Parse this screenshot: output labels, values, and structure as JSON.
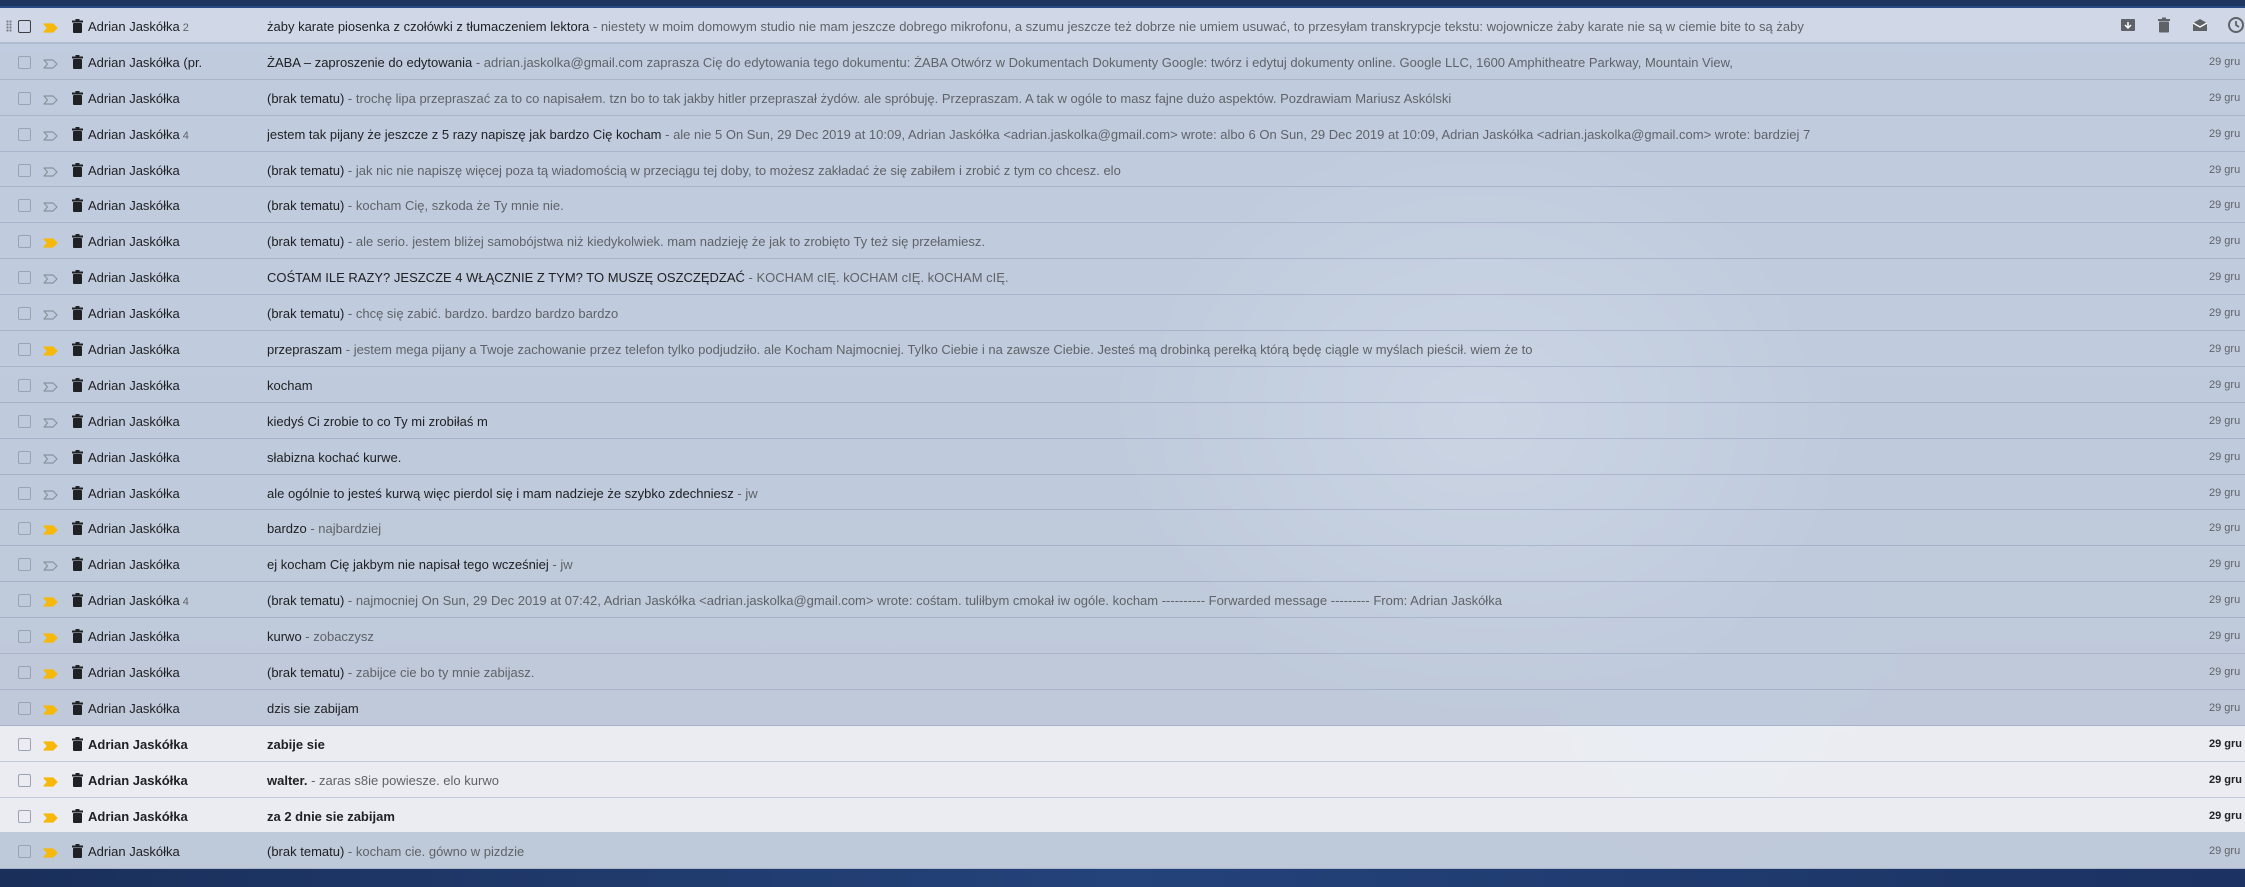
{
  "colors": {
    "important_marker": "#f6b80a",
    "not_important_marker": "#8a929c",
    "row_bg": "#dae2ee",
    "unread_row_bg": "#f6f7fa"
  },
  "hover_actions": {
    "icons": [
      "archive-icon",
      "delete-icon",
      "mark-read-icon",
      "snooze-icon"
    ]
  },
  "emails": [
    {
      "sender": "Adrian Jaskółka",
      "count": "2",
      "subject": "żaby karate piosenka z czołówki z tłumaczeniem lektora",
      "snippet": " - niestety w moim domowym studio nie mam jeszcze dobrego mikrofonu, a szumu jeszcze też dobrze nie umiem usuwać, to przesyłam transkrypcje tekstu: wojownicze żaby karate nie są w ciemie bite to są żaby",
      "date": "",
      "important": true,
      "unread": false,
      "hovered": true
    },
    {
      "sender": "Adrian Jaskółka (pr.",
      "count": "",
      "subject": "ŻABA – zaproszenie do edytowania",
      "snippet": " - adrian.jaskolka@gmail.com zaprasza Cię do edytowania tego dokumentu: ŻABA Otwórz w Dokumentach Dokumenty Google: twórz i edytuj dokumenty online. Google LLC, 1600 Amphitheatre Parkway, Mountain View,",
      "date": "29 gru",
      "important": false,
      "unread": false
    },
    {
      "sender": "Adrian Jaskółka",
      "count": "",
      "subject": "(brak tematu)",
      "snippet": " - trochę lipa przepraszać za to co napisałem. tzn bo to tak jakby hitler przepraszał żydów. ale spróbuję. Przepraszam. A tak w ogóle to masz fajne dużo aspektów. Pozdrawiam Mariusz Askólski",
      "date": "29 gru",
      "important": false,
      "unread": false
    },
    {
      "sender": "Adrian Jaskółka",
      "count": "4",
      "subject": "jestem tak pijany że jeszcze z 5 razy napiszę jak bardzo Cię kocham",
      "snippet": " - ale nie 5 On Sun, 29 Dec 2019 at 10:09, Adrian Jaskółka <adrian.jaskolka@gmail.com> wrote: albo 6 On Sun, 29 Dec 2019 at 10:09, Adrian Jaskółka <adrian.jaskolka@gmail.com> wrote: bardziej 7",
      "date": "29 gru",
      "important": false,
      "unread": false
    },
    {
      "sender": "Adrian Jaskółka",
      "count": "",
      "subject": "(brak tematu)",
      "snippet": " - jak nic nie napiszę więcej poza tą wiadomością w przeciągu tej doby, to możesz zakładać że się zabiłem i zrobić z tym co chcesz. elo",
      "date": "29 gru",
      "important": false,
      "unread": false
    },
    {
      "sender": "Adrian Jaskółka",
      "count": "",
      "subject": "(brak tematu)",
      "snippet": " - kocham Cię, szkoda że Ty mnie nie.",
      "date": "29 gru",
      "important": false,
      "unread": false
    },
    {
      "sender": "Adrian Jaskółka",
      "count": "",
      "subject": "(brak tematu)",
      "snippet": " - ale serio. jestem bliżej samobójstwa niż kiedykolwiek. mam nadzieję że jak to zrobięto Ty też się przełamiesz.",
      "date": "29 gru",
      "important": true,
      "unread": false
    },
    {
      "sender": "Adrian Jaskółka",
      "count": "",
      "subject": "COŚTAM ILE RAZY? JESZCZE 4 WŁĄCZNIE Z TYM? TO MUSZĘ OSZCZĘDZAĆ",
      "snippet": " - KOCHAM cIĘ. kOCHAM cIĘ. kOCHAM cIĘ.",
      "date": "29 gru",
      "important": false,
      "unread": false
    },
    {
      "sender": "Adrian Jaskółka",
      "count": "",
      "subject": "(brak tematu)",
      "snippet": " - chcę się zabić. bardzo. bardzo bardzo bardzo",
      "date": "29 gru",
      "important": false,
      "unread": false
    },
    {
      "sender": "Adrian Jaskółka",
      "count": "",
      "subject": "przepraszam",
      "snippet": " - jestem mega pijany a Twoje zachowanie przez telefon tylko podjudziło. ale Kocham Najmocniej. Tylko Ciebie i na zawsze Ciebie. Jesteś mą drobinką perełką którą będę ciągle w myślach pieścił. wiem że to",
      "date": "29 gru",
      "important": true,
      "unread": false
    },
    {
      "sender": "Adrian Jaskółka",
      "count": "",
      "subject": "kocham",
      "snippet": "",
      "date": "29 gru",
      "important": false,
      "unread": false
    },
    {
      "sender": "Adrian Jaskółka",
      "count": "",
      "subject": "kiedyś Ci zrobie to co Ty mi zrobiłaś m",
      "snippet": "",
      "date": "29 gru",
      "important": false,
      "unread": false
    },
    {
      "sender": "Adrian Jaskółka",
      "count": "",
      "subject": "słabizna kochać kurwe.",
      "snippet": "",
      "date": "29 gru",
      "important": false,
      "unread": false
    },
    {
      "sender": "Adrian Jaskółka",
      "count": "",
      "subject": "ale ogólnie to jesteś kurwą więc pierdol się i mam nadzieje że szybko zdechniesz",
      "snippet": " - jw",
      "date": "29 gru",
      "important": false,
      "unread": false
    },
    {
      "sender": "Adrian Jaskółka",
      "count": "",
      "subject": "bardzo",
      "snippet": " - najbardziej",
      "date": "29 gru",
      "important": true,
      "unread": false
    },
    {
      "sender": "Adrian Jaskółka",
      "count": "",
      "subject": "ej kocham Cię jakbym nie napisał tego wcześniej",
      "snippet": " - jw",
      "date": "29 gru",
      "important": false,
      "unread": false
    },
    {
      "sender": "Adrian Jaskółka",
      "count": "4",
      "subject": "(brak tematu)",
      "snippet": " - najmocniej On Sun, 29 Dec 2019 at 07:42, Adrian Jaskółka <adrian.jaskolka@gmail.com> wrote: cośtam. tuliłbym cmokał iw ogóle. kocham ---------- Forwarded message --------- From: Adrian Jaskółka",
      "date": "29 gru",
      "important": true,
      "unread": false
    },
    {
      "sender": "Adrian Jaskółka",
      "count": "",
      "subject": "kurwo",
      "snippet": " - zobaczysz",
      "date": "29 gru",
      "important": true,
      "unread": false
    },
    {
      "sender": "Adrian Jaskółka",
      "count": "",
      "subject": "(brak tematu)",
      "snippet": " - zabijce cie bo ty mnie zabijasz.",
      "date": "29 gru",
      "important": true,
      "unread": false
    },
    {
      "sender": "Adrian Jaskółka",
      "count": "",
      "subject": "dzis sie zabijam",
      "snippet": "",
      "date": "29 gru",
      "important": true,
      "unread": false
    },
    {
      "sender": "Adrian Jaskółka",
      "count": "",
      "subject": "zabije sie",
      "snippet": "",
      "date": "29 gru",
      "important": true,
      "unread": true
    },
    {
      "sender": "Adrian Jaskółka",
      "count": "",
      "subject": "walter.",
      "snippet": " - zaras s8ie powiesze. elo kurwo",
      "date": "29 gru",
      "important": true,
      "unread": true
    },
    {
      "sender": "Adrian Jaskółka",
      "count": "",
      "subject": "za 2 dnie sie zabijam",
      "snippet": "",
      "date": "29 gru",
      "important": true,
      "unread": true
    },
    {
      "sender": "Adrian Jaskółka",
      "count": "",
      "subject": "(brak tematu)",
      "snippet": " - kocham cie. gówno w pizdzie",
      "date": "29 gru",
      "important": true,
      "unread": false
    }
  ]
}
